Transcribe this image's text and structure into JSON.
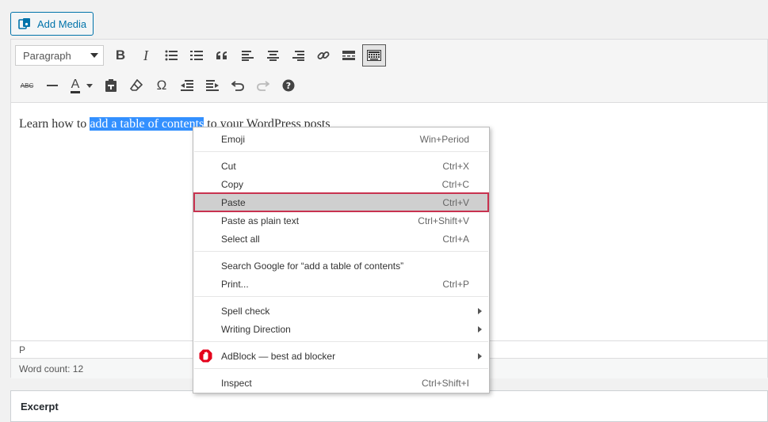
{
  "add_media": {
    "label": "Add Media"
  },
  "toolbar": {
    "format_select": "Paragraph",
    "row1": [
      "bold-icon",
      "italic-icon",
      "bullet-list-icon",
      "numbered-list-icon",
      "blockquote-icon",
      "align-left-icon",
      "align-center-icon",
      "align-right-icon",
      "link-icon",
      "read-more-icon",
      "toolbar-toggle-icon"
    ],
    "row2": [
      "strikethrough-icon",
      "horizontal-line-icon",
      "text-color-icon",
      "paste-as-text-icon",
      "clear-formatting-icon",
      "special-character-icon",
      "outdent-icon",
      "indent-icon",
      "undo-icon",
      "redo-icon",
      "help-icon"
    ],
    "bold": "B",
    "italic": "I",
    "text_color": "A",
    "omega": "Ω",
    "abc": "ABC"
  },
  "content": {
    "before": "Learn how to ",
    "selected": "add a table of contents",
    "after": " to your WordPress posts"
  },
  "status": {
    "path": "P",
    "word_count": "Word count: 12"
  },
  "excerpt": {
    "title": "Excerpt"
  },
  "context_menu": {
    "items": [
      {
        "label": "Emoji",
        "shortcut": "Win+Period"
      },
      {
        "label": "Cut",
        "shortcut": "Ctrl+X"
      },
      {
        "label": "Copy",
        "shortcut": "Ctrl+C"
      },
      {
        "label": "Paste",
        "shortcut": "Ctrl+V"
      },
      {
        "label": "Paste as plain text",
        "shortcut": "Ctrl+Shift+V"
      },
      {
        "label": "Select all",
        "shortcut": "Ctrl+A"
      },
      {
        "label": "Search Google for “add a table of contents”",
        "shortcut": ""
      },
      {
        "label": "Print...",
        "shortcut": "Ctrl+P"
      },
      {
        "label": "Spell check",
        "shortcut": ""
      },
      {
        "label": "Writing Direction",
        "shortcut": ""
      },
      {
        "label": "AdBlock — best ad blocker",
        "shortcut": ""
      },
      {
        "label": "Inspect",
        "shortcut": "Ctrl+Shift+I"
      }
    ]
  },
  "colors": {
    "accent": "#0073aa",
    "selection": "#3390ff",
    "highlight_border": "#c8324f",
    "adblock_red": "#e4001b"
  }
}
